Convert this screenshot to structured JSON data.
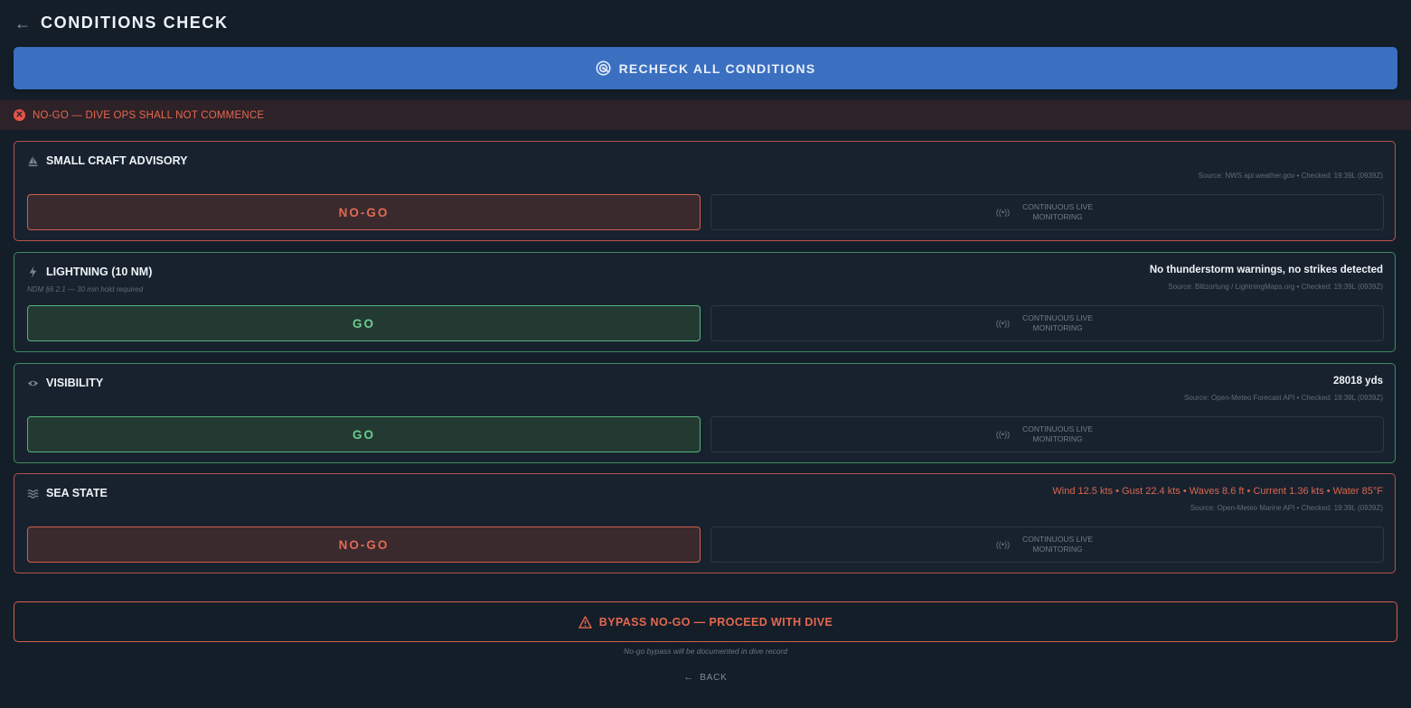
{
  "header": {
    "title": "CONDITIONS CHECK",
    "back_icon": "arrow-left-icon"
  },
  "recheck": {
    "label": "RECHECK ALL CONDITIONS",
    "icon": "radar-icon"
  },
  "banner": {
    "text": "NO-GO — DIVE OPS SHALL NOT COMMENCE",
    "icon": "x-circle-icon"
  },
  "conditions": [
    {
      "name": "SMALL CRAFT ADVISORY",
      "icon": "sailboat-icon",
      "subtitle": "",
      "reading": "",
      "source": "Source: NWS api.weather.gov  •  Checked: 19:39L (0939Z)",
      "status": "NO-GO",
      "monitor": "CONTINUOUS LIVE MONITORING"
    },
    {
      "name": "LIGHTNING (10 NM)",
      "icon": "bolt-icon",
      "subtitle": "NDM §6 2.1 — 30 min hold required",
      "reading": "No thunderstorm warnings, no strikes detected",
      "source": "Source: Blitzortung / LightningMaps.org  •  Checked: 19:39L (0939Z)",
      "status": "GO",
      "monitor": "CONTINUOUS LIVE MONITORING"
    },
    {
      "name": "VISIBILITY",
      "icon": "eye-icon",
      "subtitle": "",
      "reading": "28018 yds",
      "source": "Source: Open-Meteo Forecast API  •  Checked: 19:39L (0939Z)",
      "status": "GO",
      "monitor": "CONTINUOUS LIVE MONITORING"
    },
    {
      "name": "SEA STATE",
      "icon": "waves-icon",
      "subtitle": "",
      "reading": "Wind 12.5 kts  •  Gust 22.4 kts  •  Waves 8.6 ft  •  Current 1.36 kts  •  Water 85°F",
      "source": "Source: Open-Meteo Marine API  •  Checked: 19:39L (0939Z)",
      "status": "NO-GO",
      "monitor": "CONTINUOUS LIVE MONITORING"
    }
  ],
  "bypass": {
    "label": "BYPASS NO-GO — PROCEED WITH DIVE",
    "icon": "warning-triangle-icon",
    "note": "No-go bypass will be documented in dive record"
  },
  "back": {
    "label": "BACK",
    "icon": "arrow-left-icon"
  },
  "colors": {
    "background": "#141e29",
    "primary": "#3b6fc0",
    "nogo": "#df6a55",
    "go": "#6ccd8d"
  }
}
